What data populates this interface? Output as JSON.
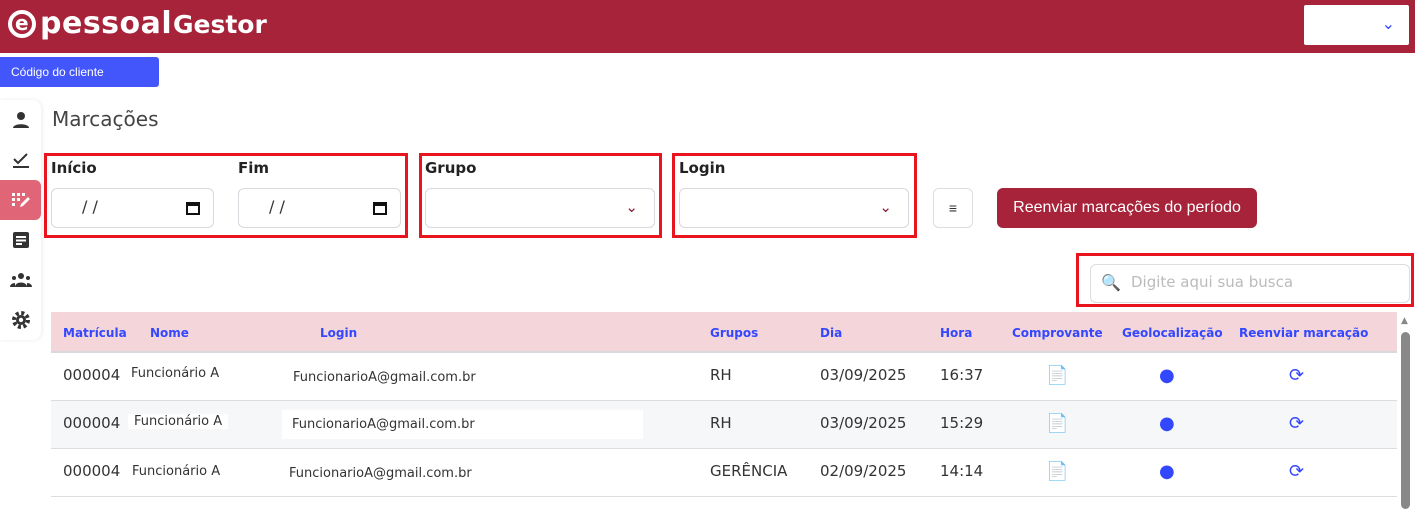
{
  "header": {
    "brand": "pessoal",
    "brand_mark": "e",
    "app": "Gestor"
  },
  "client_code_label": "Código do cliente",
  "page_title": "Marcações",
  "filters": {
    "start_label": "Início",
    "end_label": "Fim",
    "date_placeholder": "/ /",
    "group_label": "Grupo",
    "login_label": "Login",
    "resend_label": "Reenviar marcações do período"
  },
  "search": {
    "placeholder": "Digite aqui sua busca"
  },
  "table": {
    "columns": [
      "Matrícula",
      "Nome",
      "Login",
      "Grupos",
      "Dia",
      "Hora",
      "Comprovante",
      "Geolocalização",
      "Reenviar marcação"
    ],
    "rows": [
      {
        "matricula": "000004",
        "nome": "Funcionário A",
        "login": "FuncionarioA@gmail.com.br",
        "grupo": "RH",
        "dia": "03/09/2025",
        "hora": "16:37"
      },
      {
        "matricula": "000004",
        "nome": "Funcionário A",
        "login": "FuncionarioA@gmail.com.br",
        "grupo": "RH",
        "dia": "03/09/2025",
        "hora": "15:29"
      },
      {
        "matricula": "000004",
        "nome": "Funcionário A",
        "login": "FuncionarioA@gmail.com.br",
        "grupo": "GERÊNCIA",
        "dia": "02/09/2025",
        "hora": "14:14"
      }
    ]
  },
  "colors": {
    "brand": "#a6233a",
    "accent": "#3347ff",
    "highlight": "#e8141e"
  }
}
